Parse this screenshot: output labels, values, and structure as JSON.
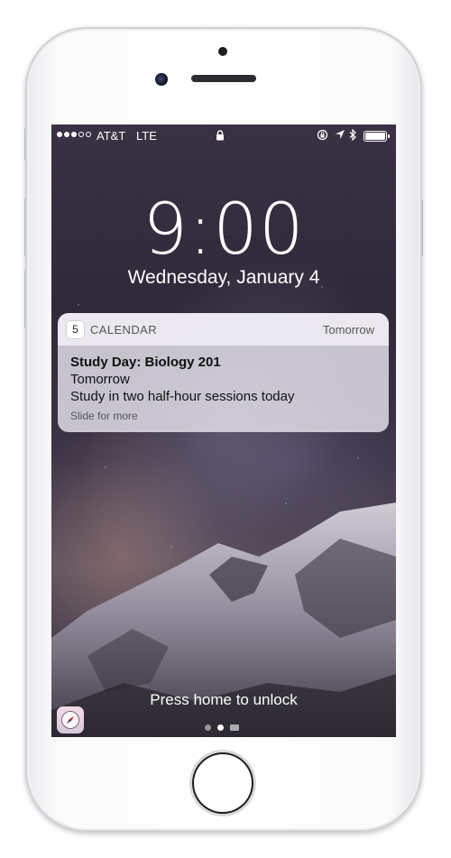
{
  "status_bar": {
    "carrier": "AT&T",
    "network": "LTE",
    "signal_bars": 3,
    "signal_total": 5
  },
  "lock_screen": {
    "time": "9:00",
    "date": "Wednesday, January 4",
    "unlock_hint": "Press home to unlock",
    "page_count": 2,
    "active_page": 1
  },
  "notification": {
    "app_icon_day": "5",
    "app_name": "CALENDAR",
    "when": "Tomorrow",
    "title": "Study Day: Biology 201",
    "line1": "Tomorrow",
    "line2": "Study in two half-hour sessions today",
    "action_hint": "Slide for more"
  },
  "icons": {
    "status_left": [
      "signal-dots-icon"
    ],
    "status_center": [
      "lock-icon"
    ],
    "status_right": [
      "rotation-lock-icon",
      "location-arrow-icon",
      "bluetooth-icon",
      "battery-icon"
    ],
    "quick_launch": "compass-icon",
    "camera_page": "camera-icon"
  },
  "colors": {
    "notification_bg": "#DCD8E2",
    "text_primary": "#111111",
    "text_secondary": "#555555"
  }
}
